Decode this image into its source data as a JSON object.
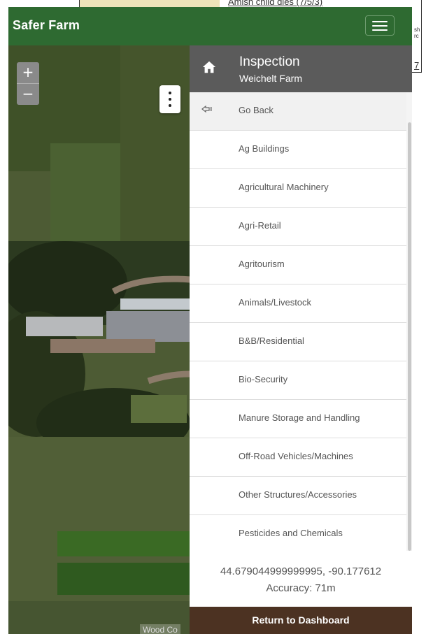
{
  "background_page": {
    "headline": "Amish child dies (7/5/3)",
    "side_snippet": [
      "sh",
      "rc"
    ],
    "side_number": "7"
  },
  "app": {
    "title": "Safer Farm"
  },
  "map": {
    "zoom_in": "+",
    "zoom_out": "−",
    "attribution": "Wood Co"
  },
  "panel": {
    "title": "Inspection",
    "subtitle": "Weichelt Farm",
    "back_label": "Go Back",
    "items": [
      {
        "label": "Ag Buildings"
      },
      {
        "label": "Agricultural Machinery"
      },
      {
        "label": "Agri-Retail"
      },
      {
        "label": "Agritourism"
      },
      {
        "label": "Animals/Livestock"
      },
      {
        "label": "B&B/Residential"
      },
      {
        "label": "Bio-Security"
      },
      {
        "label": "Manure Storage and Handling"
      },
      {
        "label": "Off-Road Vehicles/Machines"
      },
      {
        "label": "Other Structures/Accessories"
      },
      {
        "label": "Pesticides and Chemicals"
      }
    ],
    "coordinates": "44.679044999999995, -90.177612",
    "accuracy": "Accuracy: 71m",
    "return_label": "Return to Dashboard"
  },
  "colors": {
    "header_green": "#2e6a31",
    "panel_header": "#5b5b5b",
    "return_brown": "#4c3222"
  },
  "icons": {
    "menu": "hamburger-icon",
    "home": "home-icon",
    "back": "back-pointer-icon",
    "kebab": "kebab-icon"
  }
}
